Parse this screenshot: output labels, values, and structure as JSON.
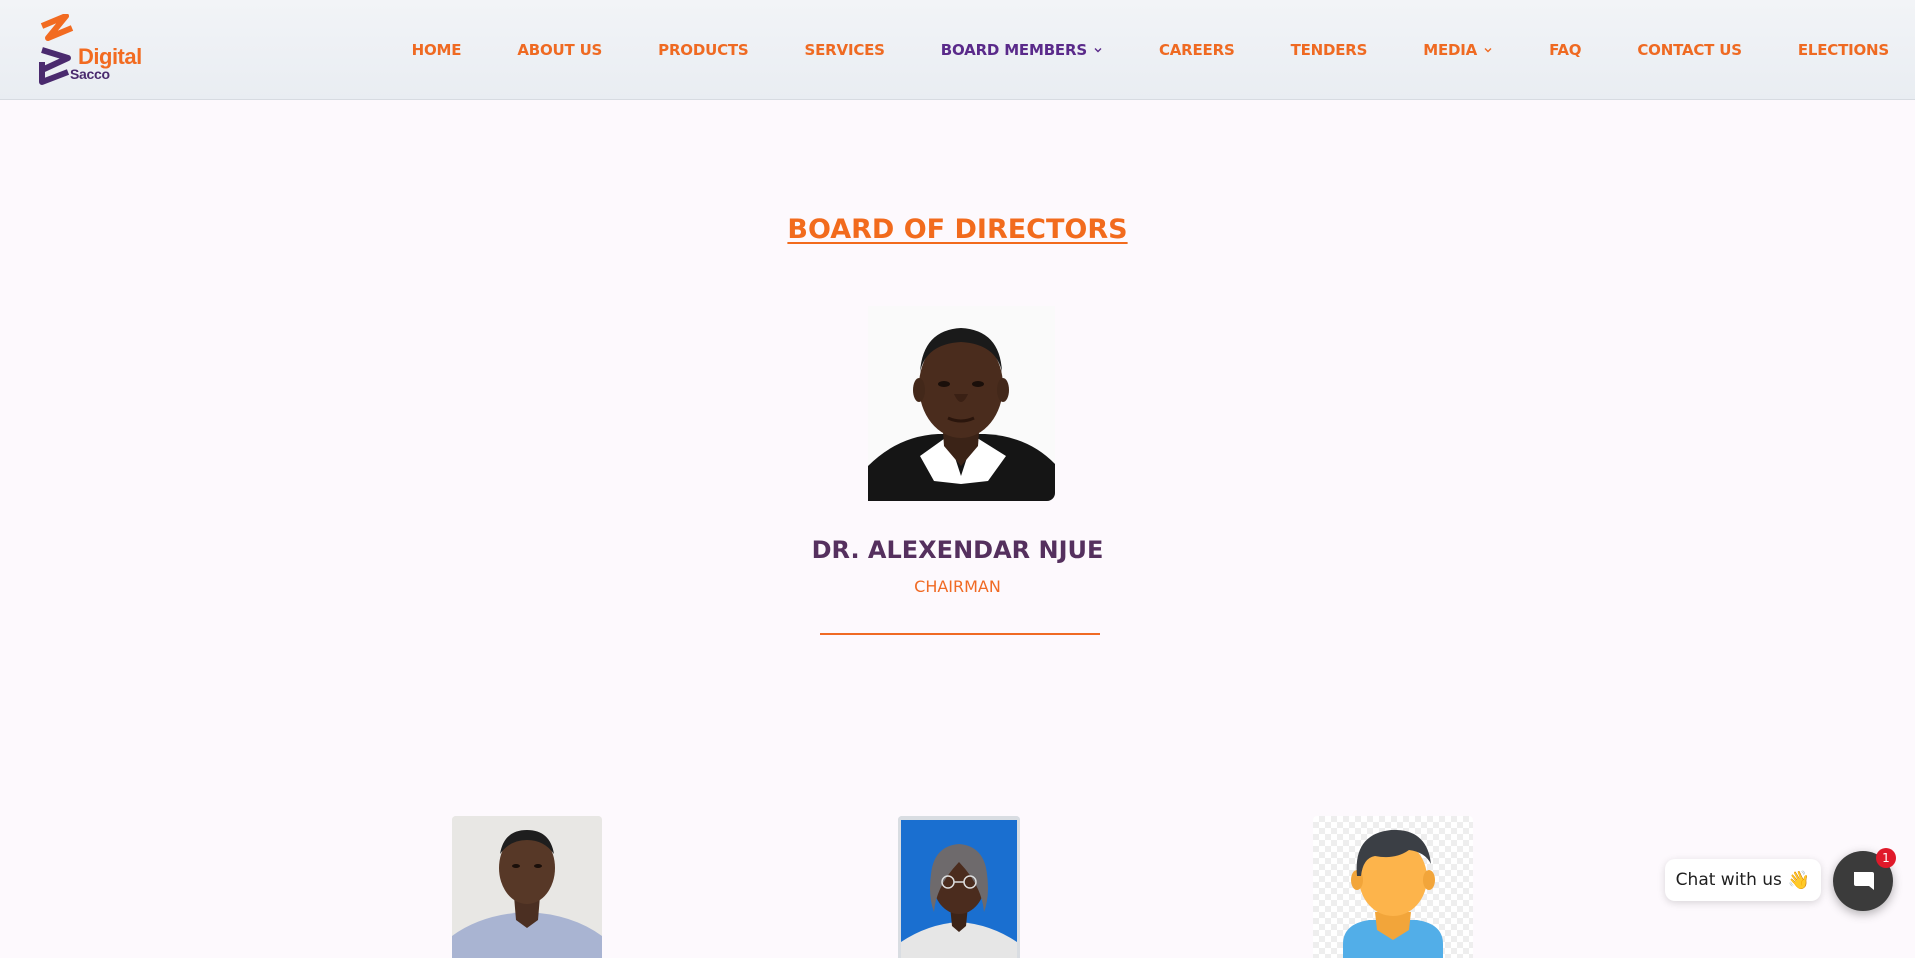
{
  "logo": {
    "word1": "Digital",
    "word2": "Sacco",
    "icon": "digital-sacco-logo"
  },
  "nav": {
    "items": [
      {
        "label": "HOME"
      },
      {
        "label": "ABOUT US"
      },
      {
        "label": "PRODUCTS"
      },
      {
        "label": "SERVICES"
      },
      {
        "label": "BOARD MEMBERS",
        "has_dropdown": true,
        "active": true
      },
      {
        "label": "CAREERS"
      },
      {
        "label": "TENDERS"
      },
      {
        "label": "MEDIA",
        "has_dropdown": true
      },
      {
        "label": "FAQ"
      },
      {
        "label": "CONTACT US"
      },
      {
        "label": "ELECTIONS"
      }
    ]
  },
  "page": {
    "title": "BOARD OF DIRECTORS",
    "chairman": {
      "name": "DR. ALEXENDAR NJUE",
      "role": "CHAIRMAN"
    }
  },
  "chat": {
    "bubble_label": "Chat with us",
    "wave_icon": "waving-hand-icon",
    "badge_count": "1"
  },
  "colors": {
    "accent": "#f26b21",
    "brand_purple": "#5a2a8a",
    "name_color": "#55305e"
  }
}
